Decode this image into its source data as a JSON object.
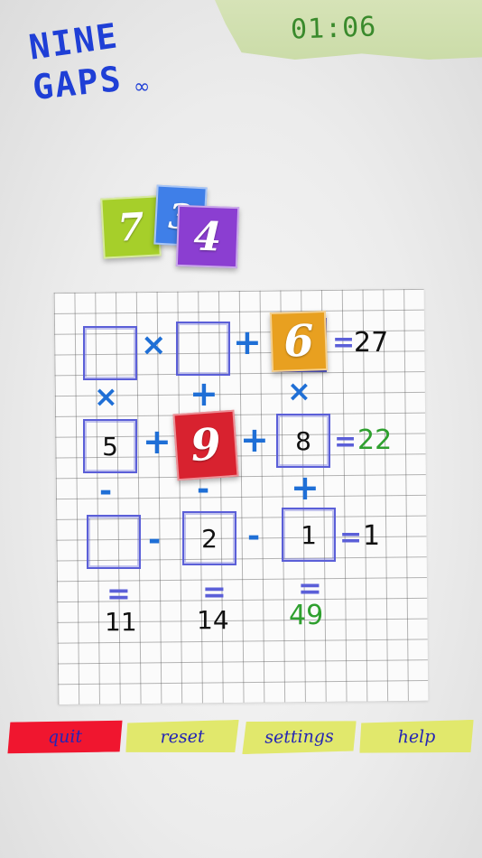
{
  "logo": {
    "line1": "NINE",
    "line2": "GAPS",
    "mode_symbol": "∞"
  },
  "timer": "01:06",
  "tray": [
    {
      "value": "7",
      "color": "#a6cf2a"
    },
    {
      "value": "3",
      "color": "#3f7fe8"
    },
    {
      "value": "4",
      "color": "#8b3ed1"
    }
  ],
  "puzzle": {
    "rows": [
      {
        "cells": [
          "",
          "",
          "6"
        ],
        "ops": [
          "×",
          "+"
        ],
        "equals": "=",
        "result": "27",
        "result_color": "black"
      },
      {
        "cells": [
          "5",
          "9",
          "8"
        ],
        "ops": [
          "+",
          "+"
        ],
        "equals": "=",
        "result": "22",
        "result_color": "green"
      },
      {
        "cells": [
          "",
          "2",
          "1"
        ],
        "ops": [
          "-",
          "-"
        ],
        "equals": "=",
        "result": "1",
        "result_color": "black"
      }
    ],
    "col_ops_top": [
      "×",
      "+",
      "×"
    ],
    "col_ops_bottom": [
      "-",
      "-",
      "+"
    ],
    "col_equals": [
      "=",
      "=",
      "="
    ],
    "col_results": [
      "11",
      "14",
      "49"
    ],
    "col_result_colors": [
      "black",
      "black",
      "green"
    ],
    "placed_tiles": [
      {
        "cell": "r1c3",
        "value": "6",
        "color": "#e8a020"
      },
      {
        "cell": "r2c2",
        "value": "9",
        "color": "#d8222f"
      }
    ]
  },
  "buttons": {
    "quit": "quit",
    "reset": "reset",
    "settings": "settings",
    "help": "help"
  },
  "colors": {
    "ink_blue": "#1f6fd6",
    "box_outline": "#5b5fd8",
    "correct_green": "#2fa02f",
    "quit_red": "#f0162f",
    "button_yellow": "#e1e86c"
  }
}
